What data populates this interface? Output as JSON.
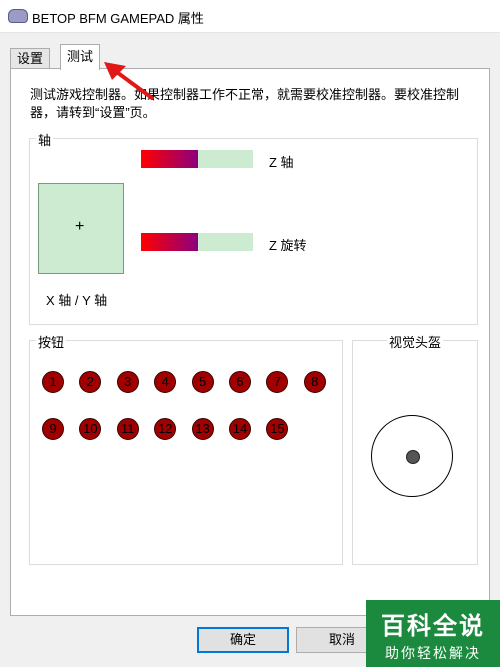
{
  "window": {
    "title": "BETOP BFM GAMEPAD 属性"
  },
  "tabs": [
    {
      "label": "设置",
      "active": false
    },
    {
      "label": "测试",
      "active": true
    }
  ],
  "description": "测试游戏控制器。如果控制器工作不正常，就需要校准控制器。要校准控制器，请转到“设置”页。",
  "axes": {
    "title": "轴",
    "z_axis_label": "Z 轴",
    "z_axis_value": 0.5,
    "z_rotation_label": "Z 旋转",
    "z_rotation_value": 0.5,
    "xy_label": "X 轴 / Y 轴",
    "xy_marker": "+"
  },
  "buttons": {
    "title": "按钮",
    "items": [
      "1",
      "2",
      "3",
      "4",
      "5",
      "6",
      "7",
      "8",
      "9",
      "10",
      "11",
      "12",
      "13",
      "14",
      "15"
    ]
  },
  "pov": {
    "title": "视觉头盔"
  },
  "dialog": {
    "ok_label": "确定",
    "cancel_label": "取消"
  },
  "watermark": {
    "line1": "百科全说",
    "line2": "助你轻松解决"
  },
  "colors": {
    "accent": "#0078d7",
    "bar_bg": "#cdebd0",
    "button_red": "#a00000",
    "watermark_green": "#1b8a3e"
  }
}
